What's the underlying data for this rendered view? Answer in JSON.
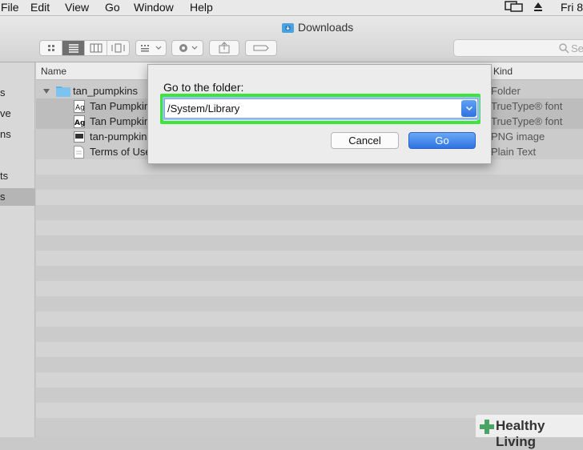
{
  "menubar": {
    "items": [
      "File",
      "Edit",
      "View",
      "Go",
      "Window",
      "Help"
    ],
    "clock": "Fri 8"
  },
  "window": {
    "title": "Downloads",
    "search_placeholder": "Sea"
  },
  "sidebar": {
    "items": [
      "s",
      "ve",
      "ns",
      "ts",
      "s"
    ]
  },
  "columns": {
    "name": "Name",
    "kind": "Kind"
  },
  "files": [
    {
      "name": "tan_pumpkins",
      "kind": "Folder",
      "icon": "folder-icon"
    },
    {
      "name": "Tan Pumpkin",
      "kind": "TrueType® font",
      "icon": "font-file-icon"
    },
    {
      "name": "Tan Pumpkin",
      "kind": "TrueType® font",
      "icon": "font-file-icon"
    },
    {
      "name": "tan-pumpkins",
      "kind": "PNG image",
      "icon": "image-file-icon"
    },
    {
      "name": "Terms of Use",
      "kind": "Plain Text",
      "icon": "text-file-icon"
    }
  ],
  "dialog": {
    "label": "Go to the folder:",
    "path_value": "/System/Library",
    "cancel_label": "Cancel",
    "go_label": "Go"
  },
  "brand": {
    "text": "Healthy Living"
  },
  "colors": {
    "highlight": "#3ce43c",
    "accent": "#2f73e0"
  }
}
